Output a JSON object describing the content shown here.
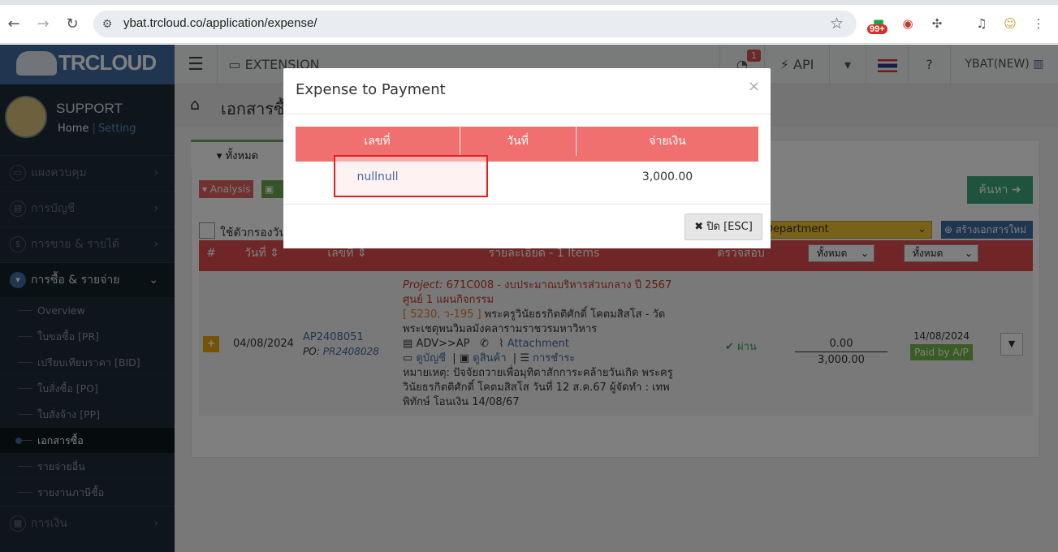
{
  "browser": {
    "url": "ybat.trcloud.co/application/expense/",
    "ext_badge": "99+"
  },
  "app": {
    "logo": "TRCLOUD",
    "user": {
      "name": "SUPPORT",
      "home": "Home",
      "sep": "|",
      "setting": "Setting"
    },
    "topbar": {
      "extension": "EXTENSION",
      "api": "API",
      "company": "YBAT(NEW)",
      "notif_count": "1"
    },
    "sidebar": {
      "items": [
        {
          "label": "แผงควบคุม"
        },
        {
          "label": "การบัญชี"
        },
        {
          "label": "การขาย & รายได้"
        },
        {
          "label": "การซื้อ & รายจ่าย"
        },
        {
          "label": "การเงิน"
        }
      ],
      "sub": [
        "Overview",
        "ใบขอซื้อ [PR]",
        "เปรียบเทียบราคา [BID]",
        "ใบสั่งซื้อ [PO]",
        "ใบสั่งจ้าง [PP]",
        "เอกสารซื้อ",
        "รายจ่ายอื่น",
        "รายงานภาษีซื้อ"
      ]
    },
    "page": {
      "title": "เอกสารซื้อ",
      "tab_all": "ทั้งหมด",
      "analysis": "Analysis",
      "search": "ค้นหา",
      "filter_label": "ใช้ตัวกรองวัน",
      "department": "Department",
      "create": "สร้างเอกสารใหม่"
    },
    "table": {
      "headers": {
        "num": "#",
        "date": "วันที่",
        "doc": "เลขที่",
        "detail": "รายละเอียด - 1 Items",
        "check": "ตรวจสอบ",
        "filter1": "ทั้งหมด",
        "filter2": "ทั้งหมด"
      },
      "row": {
        "date": "04/08/2024",
        "doc": "AP2408051",
        "po_label": "PO:",
        "po": "PR2408028",
        "project_label": "Project:",
        "project": "671C008 - งบประมาณบริหารส่วนกลาง ปี 2567 ศูนย์ 1 แผนกิจกรรม",
        "code": "[ 5230, ว-195 ]",
        "vendor": "พระครูวินัยธรกิตติศักดิ์ โคตมสิสโส - วัดพระเชตุพนวิมลมังคลารามราชวรมหาวิหาร",
        "adv": "ADV>>AP",
        "attachment": "Attachment",
        "l_account": "ดูบัญชี",
        "l_goods": "ดูสินค้า",
        "l_pay": "การชำระ",
        "note": "หมายเหตุ: ปัจจัยถวายเพื่อมุทิตาสักการะคล้ายวันเกิด พระครูวินัยธรกิตติศักดิ์ โคตมสิสโส วันที่ 12 ส.ค.67 ผู้จัดทำ : เทพพิทักษ์ โอนเงิน 14/08/67",
        "status": "ผ่าน",
        "paid_amount": "0.00",
        "total": "3,000.00",
        "pay_date": "14/08/2024",
        "paid_badge": "Paid by A/P"
      }
    }
  },
  "modal": {
    "title": "Expense to Payment",
    "close_x": "×",
    "headers": {
      "num": "เลขที่",
      "date": "วันที่",
      "amount": "จ่ายเงิน"
    },
    "rows": [
      {
        "num": "nullnull",
        "date": "",
        "amount": "3,000.00"
      }
    ],
    "close_btn": "ปิด [ESC]"
  }
}
